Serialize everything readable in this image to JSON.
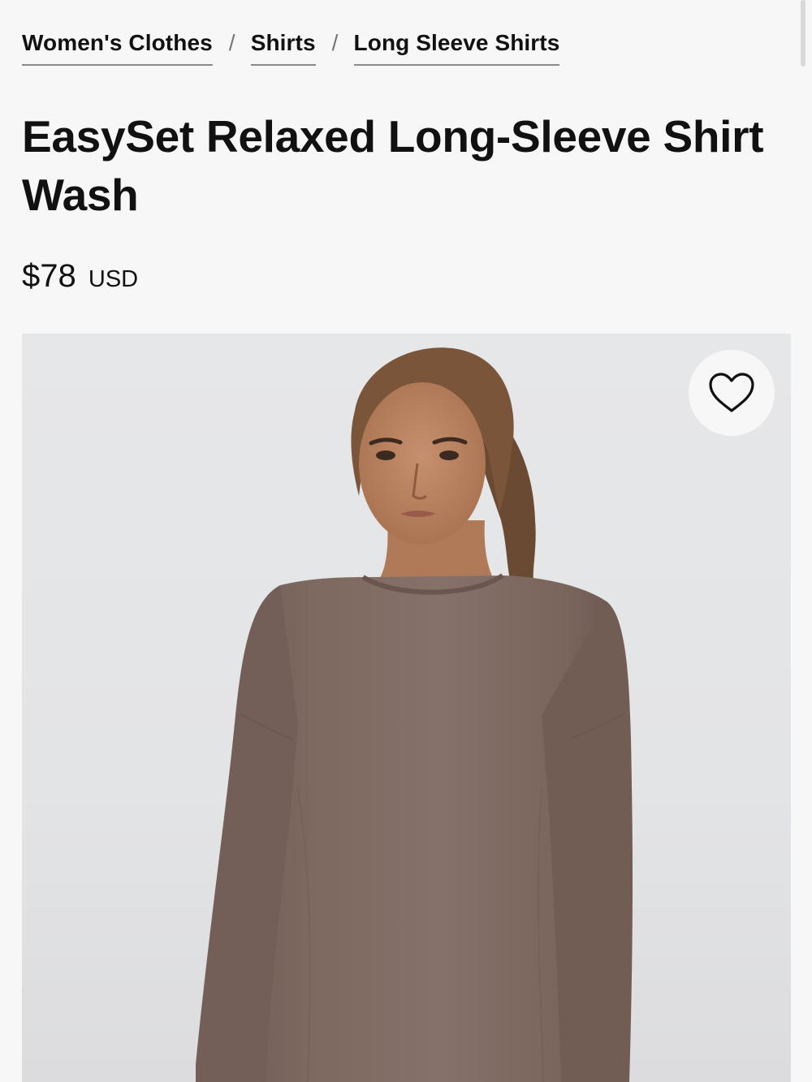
{
  "breadcrumb": {
    "items": [
      {
        "label": "Women's Clothes"
      },
      {
        "label": "Shirts"
      },
      {
        "label": "Long Sleeve Shirts"
      }
    ],
    "separator": "/"
  },
  "product": {
    "title": "EasySet Relaxed Long-Sleeve Shirt Wash",
    "price": "$78",
    "currency": "USD",
    "image_alt": "Model wearing brown relaxed long-sleeve shirt",
    "shirt_color": "#806a62"
  },
  "wishlist": {
    "icon": "heart-icon"
  }
}
